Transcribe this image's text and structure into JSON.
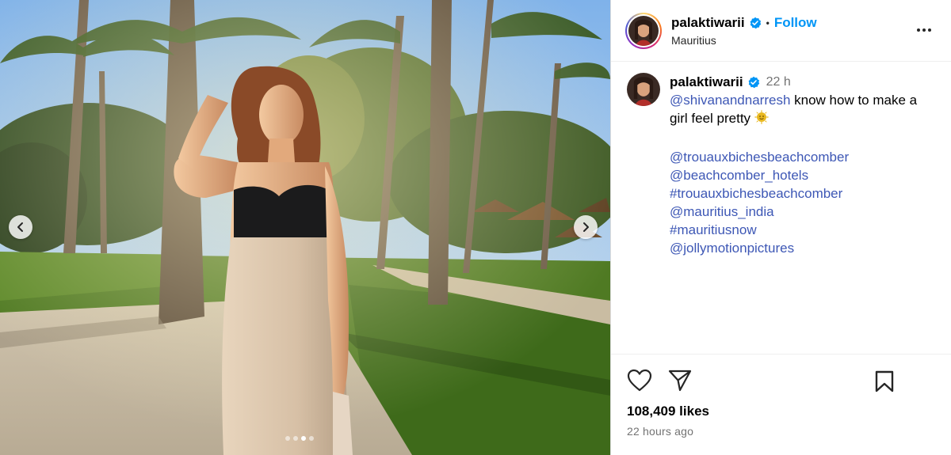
{
  "post": {
    "username": "palaktiwarii",
    "location": "Mauritius",
    "follow_label": "Follow",
    "separator": "•",
    "verified": true,
    "carousel": {
      "current_index": 3,
      "total": 4
    }
  },
  "caption": {
    "username": "palaktiwarii",
    "time_short": "22 h",
    "mention_main": "@shivanandnarresh",
    "text_main": "know how to make a girl feel pretty",
    "emoji": "sun-face-emoji",
    "tags": [
      "@trouauxbichesbeachcomber",
      "@beachcomber_hotels",
      "#trouauxbichesbeachcomber",
      "@mauritius_india",
      "#mauritiusnow",
      "@jollymotionpictures"
    ]
  },
  "stats": {
    "likes": "108,409 likes",
    "time_full": "22 hours ago"
  },
  "icons": {
    "like": "heart-icon",
    "share": "paper-plane-icon",
    "save": "bookmark-icon",
    "more": "more-horizontal-icon",
    "prev": "chevron-left-icon",
    "next": "chevron-right-icon",
    "verified": "verified-badge-icon"
  },
  "colors": {
    "link": "#3d57b5",
    "follow": "#0095f6",
    "verified": "#0095f6",
    "muted": "#737373"
  }
}
